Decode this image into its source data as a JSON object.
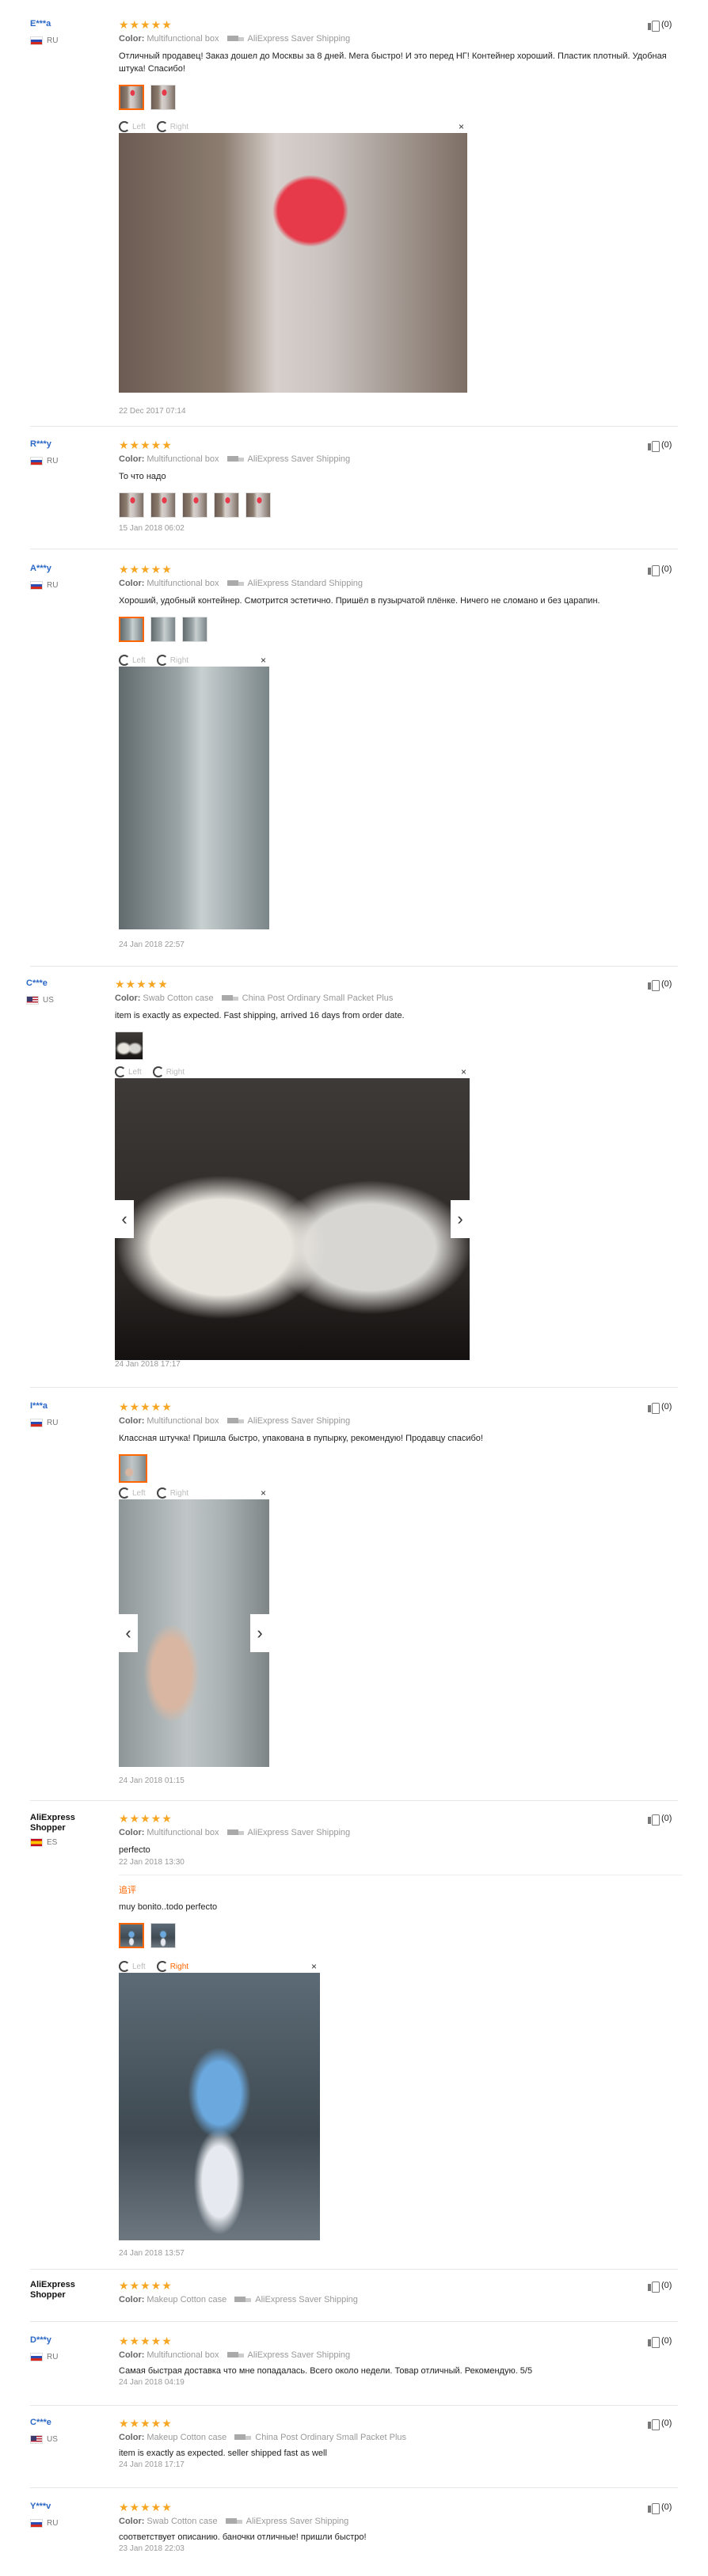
{
  "labels": {
    "color": "Color:"
  },
  "reviews": [
    {
      "user": "E***a",
      "country": "RU",
      "stars": "★★★★★",
      "color": "Multifunctional box",
      "shipping": "AliExpress Saver Shipping",
      "text": "Отличный продавец! Заказ дошел до Москвы за 8 дней. Мега быстро! И это перед НГ! Контейнер хороший. Пластик плотный. Удобная штука! Спасибо!",
      "useful": "(0)",
      "date": "22 Dec 2017 07:14",
      "viewer": {
        "left": "Left",
        "right": "Right",
        "close": "×"
      }
    },
    {
      "user": "R***y",
      "country": "RU",
      "stars": "★★★★★",
      "color": "Multifunctional box",
      "shipping": "AliExpress Saver Shipping",
      "text": "То что надо",
      "useful": "(0)",
      "date": "15 Jan 2018 06:02"
    },
    {
      "user": "A***y",
      "country": "RU",
      "stars": "★★★★★",
      "color": "Multifunctional box",
      "shipping": "AliExpress Standard Shipping",
      "text": "Хороший, удобный контейнер. Смотрится эстетично. Пришёл в пузырчатой плёнке. Ничего не сломано и без царапин.",
      "useful": "(0)",
      "date": "24 Jan 2018 22:57",
      "viewer": {
        "left": "Left",
        "right": "Right",
        "close": "×"
      }
    },
    {
      "user": "C***e",
      "country": "US",
      "stars": "★★★★★",
      "color": "Swab Cotton case",
      "shipping": "China Post Ordinary Small Packet Plus",
      "text": "item is exactly as expected. Fast shipping, arrived 16 days from order date.",
      "useful": "(0)",
      "date": "24 Jan 2018 17:17",
      "viewer": {
        "left": "Left",
        "right": "Right",
        "close": "×"
      }
    },
    {
      "user": "I***a",
      "country": "RU",
      "stars": "★★★★★",
      "color": "Multifunctional box",
      "shipping": "AliExpress Saver Shipping",
      "text": "Классная штучка! Пришла быстро, упакована в пупырку, рекомендую! Продавцу спасибо!",
      "useful": "(0)",
      "date": "24 Jan 2018 01:15",
      "viewer": {
        "left": "Left",
        "right": "Right",
        "close": "×"
      }
    },
    {
      "user": "AliExpress Shopper",
      "country": "ES",
      "stars": "★★★★★",
      "color": "Multifunctional box",
      "shipping": "AliExpress Saver Shipping",
      "text": "perfecto",
      "useful": "(0)",
      "date": "22 Jan 2018 13:30",
      "additional_label": "追评",
      "additional_text": "muy bonito..todo perfecto",
      "additional_date": "24 Jan 2018 13:57",
      "viewer": {
        "left": "Left",
        "right": "Right",
        "close": "×"
      }
    },
    {
      "user": "AliExpress Shopper",
      "country": "",
      "stars": "★★★★★",
      "color": "Makeup Cotton case",
      "shipping": "AliExpress Saver Shipping",
      "useful": "(0)"
    },
    {
      "user": "D***y",
      "country": "RU",
      "stars": "★★★★★",
      "color": "Multifunctional box",
      "shipping": "AliExpress Saver Shipping",
      "text": "Самая быстрая доставка что мне попадалась. Всего около недели. Товар отличный. Рекомендую. 5/5",
      "useful": "(0)",
      "date": "24 Jan 2018 04:19"
    },
    {
      "user": "C***e",
      "country": "US",
      "stars": "★★★★★",
      "color": "Makeup Cotton case",
      "shipping": "China Post Ordinary Small Packet Plus",
      "text": "item is exactly as expected. seller shipped fast as well",
      "useful": "(0)",
      "date": "24 Jan 2018 17:17"
    },
    {
      "user": "Y***v",
      "country": "RU",
      "stars": "★★★★★",
      "color": "Swab Cotton case",
      "shipping": "AliExpress Saver Shipping",
      "text": "соответствует описанию. баночки отличные! пришли быстро!",
      "useful": "(0)",
      "date": "23 Jan 2018 22:03"
    }
  ]
}
